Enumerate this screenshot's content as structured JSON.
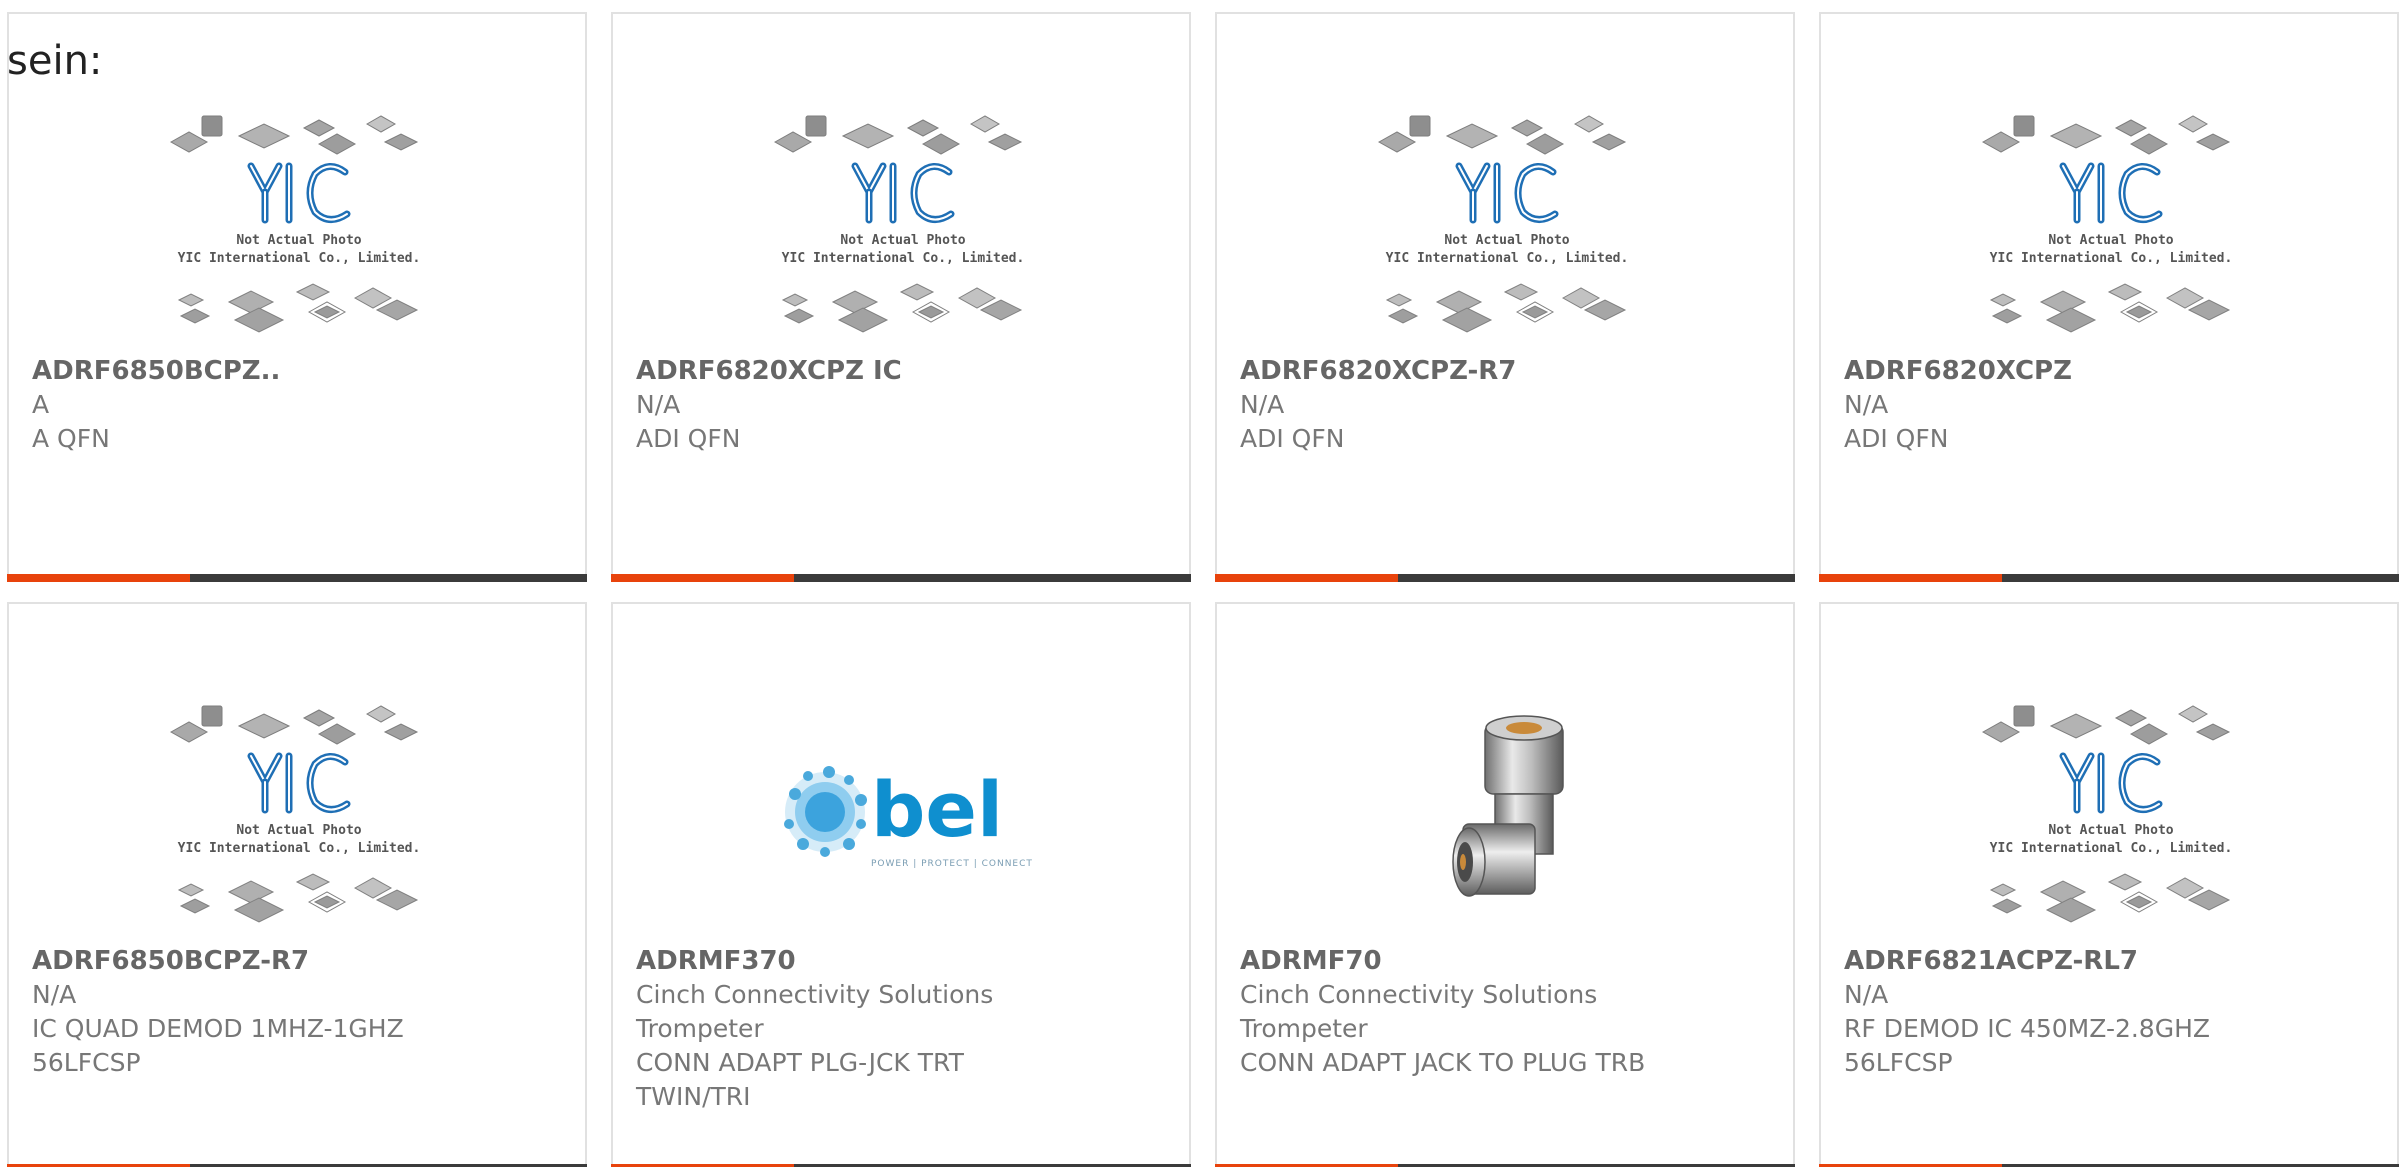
{
  "intro": {
    "text": "sein:"
  },
  "theme": {
    "accent": "#e8430c",
    "bar_dark": "#3b3b3b",
    "yic_blue": "#1f6fb5",
    "bel_blue": "#0f8fcf"
  },
  "placeholder_image": {
    "icon": "yic-placeholder-icon",
    "logo_text": "YIC",
    "caption_line1": "Not Actual Photo",
    "caption_line2": "YIC International Co., Limited."
  },
  "bel_image": {
    "icon": "bel-logo-icon",
    "brand": "bel",
    "tagline": "POWER | PROTECT | CONNECT"
  },
  "products": [
    {
      "image": "yic-placeholder",
      "part": "ADRF6850BCPZ..",
      "lines": [
        "A",
        "A QFN"
      ]
    },
    {
      "image": "yic-placeholder",
      "part": "ADRF6820XCPZ IC",
      "lines": [
        "N/A",
        "ADI QFN"
      ]
    },
    {
      "image": "yic-placeholder",
      "part": "ADRF6820XCPZ-R7",
      "lines": [
        "N/A",
        "ADI QFN"
      ]
    },
    {
      "image": "yic-placeholder",
      "part": "ADRF6820XCPZ",
      "lines": [
        "N/A",
        "ADI QFN"
      ]
    },
    {
      "image": "yic-placeholder",
      "part": "ADRF6850BCPZ-R7",
      "lines": [
        "N/A",
        "IC QUAD DEMOD 1MHZ-1GHZ",
        "56LFCSP"
      ]
    },
    {
      "image": "bel-logo",
      "part": "ADRMF370",
      "lines": [
        "Cinch Connectivity Solutions",
        "Trompeter",
        "CONN ADAPT PLG-JCK TRT",
        "TWIN/TRI"
      ]
    },
    {
      "image": "bnc-adapter",
      "part": "ADRMF70",
      "lines": [
        "Cinch Connectivity Solutions",
        "Trompeter",
        "CONN ADAPT JACK TO PLUG TRB"
      ]
    },
    {
      "image": "yic-placeholder",
      "part": "ADRF6821ACPZ-RL7",
      "lines": [
        "N/A",
        "RF DEMOD IC 450MZ-2.8GHZ",
        "56LFCSP"
      ]
    }
  ]
}
